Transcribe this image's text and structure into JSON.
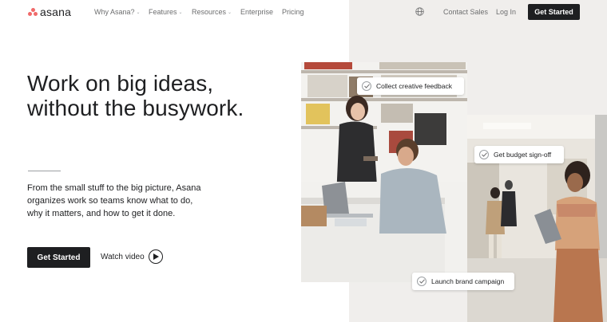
{
  "brand": {
    "name": "asana",
    "accent_color": "#f06a6a"
  },
  "nav": {
    "items": [
      {
        "label": "Why Asana?",
        "has_dropdown": true
      },
      {
        "label": "Features",
        "has_dropdown": true
      },
      {
        "label": "Resources",
        "has_dropdown": true
      },
      {
        "label": "Enterprise",
        "has_dropdown": false
      },
      {
        "label": "Pricing",
        "has_dropdown": false
      }
    ],
    "globe_icon": "globe-icon",
    "contact_label": "Contact Sales",
    "login_label": "Log In",
    "cta_label": "Get Started"
  },
  "hero": {
    "headline_line1": "Work on big ideas,",
    "headline_line2": "without the busywork.",
    "sub_line1": "From the small stuff to the big picture, Asana",
    "sub_line2": "organizes work so teams know what to do,",
    "sub_line3": "why it matters, and how to get it done.",
    "cta_label": "Get Started",
    "watch_label": "Watch video"
  },
  "callouts": [
    {
      "label": "Collect creative feedback",
      "icon": "check-icon"
    },
    {
      "label": "Get budget sign-off",
      "icon": "check-icon"
    },
    {
      "label": "Launch brand campaign",
      "icon": "check-icon"
    }
  ],
  "colors": {
    "dark": "#1e1f21",
    "panel": "#f0eeec",
    "muted": "#6d6e6f"
  }
}
